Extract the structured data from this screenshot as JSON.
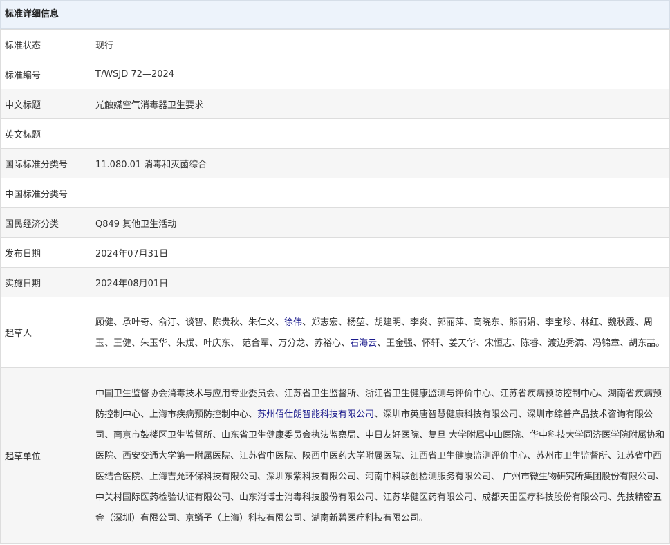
{
  "panel": {
    "title": "标准详细信息"
  },
  "rows": {
    "status": {
      "label": "标准状态",
      "value": "现行"
    },
    "number": {
      "label": "标准编号",
      "value": "T/WSJD 72—2024"
    },
    "cn_title": {
      "label": "中文标题",
      "value": "光触媒空气消毒器卫生要求"
    },
    "en_title": {
      "label": "英文标题",
      "value": ""
    },
    "ics": {
      "label": "国际标准分类号",
      "value": "11.080.01 消毒和灭菌综合"
    },
    "ccs": {
      "label": "中国标准分类号",
      "value": ""
    },
    "economy": {
      "label": "国民经济分类",
      "value": "Q849 其他卫生活动"
    },
    "publish_date": {
      "label": "发布日期",
      "value": "2024年07月31日"
    },
    "implement_date": {
      "label": "实施日期",
      "value": "2024年08月01日"
    },
    "drafters": {
      "label": "起草人",
      "part1": "顾健、承叶奇、俞汀、谈智、陈贵秋、朱仁义、",
      "link1": "徐伟",
      "part2": "、郑志宏、杨堃、胡建明、李炎、郭丽萍、高晓东、熊丽娟、李宝珍、林红、魏秋霞、周玉、王健、朱玉华、朱斌、叶庆东、 范合军、万分龙、苏裕心、",
      "link2": "石海云",
      "part3": "、王金强、怀轩、姜天华、宋恒志、陈睿、渡边秀满、冯锦章、胡东喆。"
    },
    "drafting_units": {
      "label": "起草单位",
      "part1": "中国卫生监督协会消毒技术与应用专业委员会、江苏省卫生监督所、浙江省卫生健康监测与评价中心、江苏省疾病预防控制中心、湖南省疾病预防控制中心、上海市疾病预防控制中心、",
      "link1": "苏州佰仕朗智能科技有限公司",
      "part2": "、深圳市英唐智慧健康科技有限公司、深圳市综普产品技术咨询有限公司、南京市鼓楼区卫生监督所、山东省卫生健康委员会执法监察局、中日友好医院、复旦 大学附属中山医院、华中科技大学同济医学院附属协和医院、西安交通大学第一附属医院、江苏省中医院、陕西中医药大学附属医院、江西省卫生健康监测评价中心、苏州市卫生监督所、江苏省中西医结合医院、上海吉允环保科技有限公司、深圳东紫科技有限公司、河南中科联创检测服务有限公司、 广州市微生物研究所集团股份有限公司、中关村国际医药检验认证有限公司、山东消博士消毒科技股份有限公司、江苏华健医药有限公司、成都天田医疗科技股份有限公司、先技精密五金（深圳）有限公司、京鳞子（上海）科技有限公司、湖南新碧医疗科技有限公司。"
    }
  }
}
